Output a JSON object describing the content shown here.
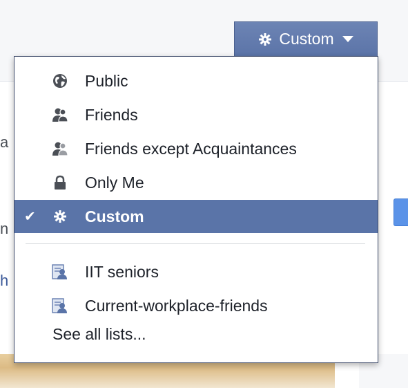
{
  "privacy_button": {
    "label": "Custom",
    "icon": "gear-icon"
  },
  "menu": {
    "options": [
      {
        "label": "Public",
        "icon": "globe-icon",
        "selected": false
      },
      {
        "label": "Friends",
        "icon": "friends-icon",
        "selected": false
      },
      {
        "label": "Friends except Acquaintances",
        "icon": "friends-except-icon",
        "selected": false
      },
      {
        "label": "Only Me",
        "icon": "lock-icon",
        "selected": false
      },
      {
        "label": "Custom",
        "icon": "gear-icon",
        "selected": true
      }
    ],
    "lists": [
      {
        "label": "IIT seniors",
        "icon": "list-icon"
      },
      {
        "label": "Current-workplace-friends",
        "icon": "list-icon"
      }
    ],
    "see_all": "See all lists..."
  },
  "background_fragments": {
    "frag1": "a",
    "frag2": "n",
    "frag3": "h"
  },
  "colors": {
    "selected_bg": "#5a74a8",
    "button_bg": "#6d84b4",
    "menu_border": "#3f4c6b",
    "text": "#1d2129"
  }
}
